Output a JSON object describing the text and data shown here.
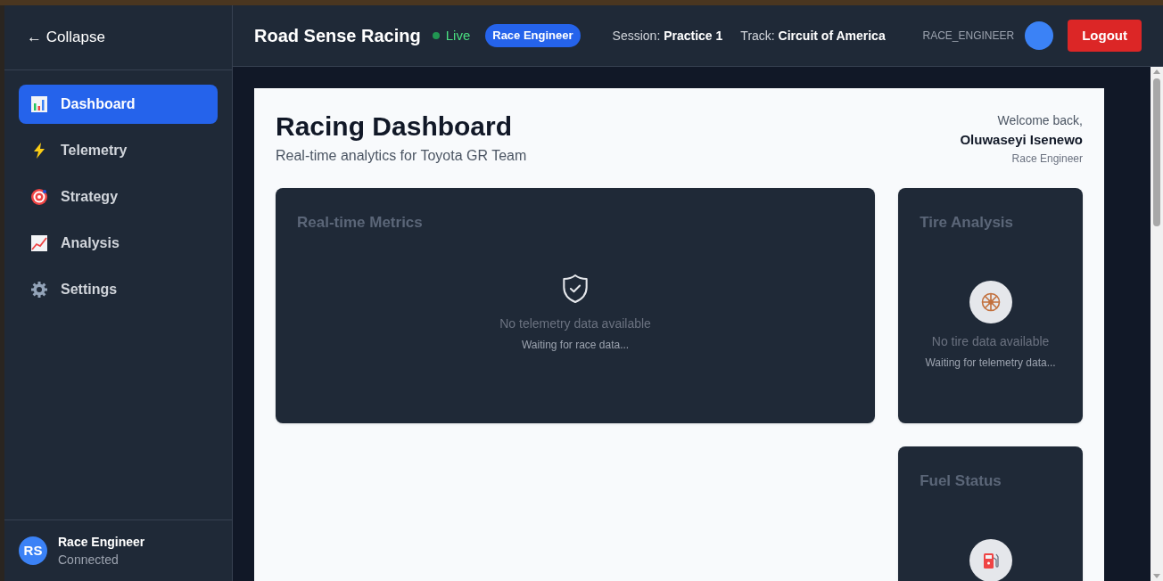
{
  "sidebar": {
    "collapse": "← Collapse",
    "items": [
      {
        "label": "Dashboard",
        "selected": true
      },
      {
        "label": "Telemetry",
        "selected": false
      },
      {
        "label": "Strategy",
        "selected": false
      },
      {
        "label": "Analysis",
        "selected": false
      },
      {
        "label": "Settings",
        "selected": false
      }
    ],
    "user": {
      "initials": "RS",
      "name": "Race Engineer",
      "status": "Connected"
    }
  },
  "header": {
    "title": "Road Sense Racing",
    "live": "Live",
    "role_badge": "Race Engineer",
    "session_label": "Session:",
    "session": "Practice 1",
    "track_label": "Track:",
    "track": "Circuit of America",
    "username": "RACE_ENGINEER",
    "logout": "Logout"
  },
  "main": {
    "title": "Racing Dashboard",
    "subtitle": "Real-time analytics for Toyota GR Team",
    "welcome": "Welcome back,",
    "user_name": "Oluwaseyi Isenewo",
    "user_role": "Race Engineer",
    "cards": [
      {
        "kind": "metrics",
        "title": "Real-time Metrics",
        "message": "No telemetry data available",
        "detail": "Waiting for race data..."
      },
      {
        "kind": "tire",
        "title": "Tire Analysis",
        "message": "No tire data available",
        "detail": "Waiting for telemetry data..."
      },
      {
        "kind": "fuel",
        "title": "Fuel Status"
      }
    ]
  }
}
